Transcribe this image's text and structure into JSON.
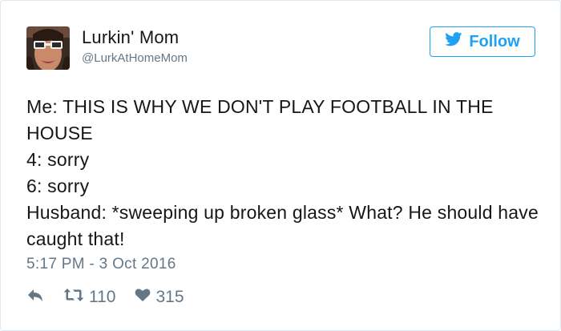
{
  "author": {
    "name": "Lurkin' Mom",
    "handle": "@LurkAtHomeMom",
    "avatar": "profile-photo"
  },
  "follow_button": {
    "label": "Follow",
    "icon": "twitter-bird-icon"
  },
  "tweet": {
    "text": "Me: THIS IS WHY WE DON'T PLAY FOOTBALL IN THE HOUSE\n4: sorry\n6: sorry\nHusband: *sweeping up broken glass* What? He should have caught that!",
    "timestamp": "5:17 PM - 3 Oct 2016"
  },
  "actions": {
    "reply_icon": "reply-icon",
    "retweet_icon": "retweet-icon",
    "retweets": "110",
    "like_icon": "heart-icon",
    "likes": "315"
  },
  "colors": {
    "accent": "#1da1f2",
    "text": "#14171a",
    "muted": "#657786",
    "border": "#e1e8ed"
  }
}
